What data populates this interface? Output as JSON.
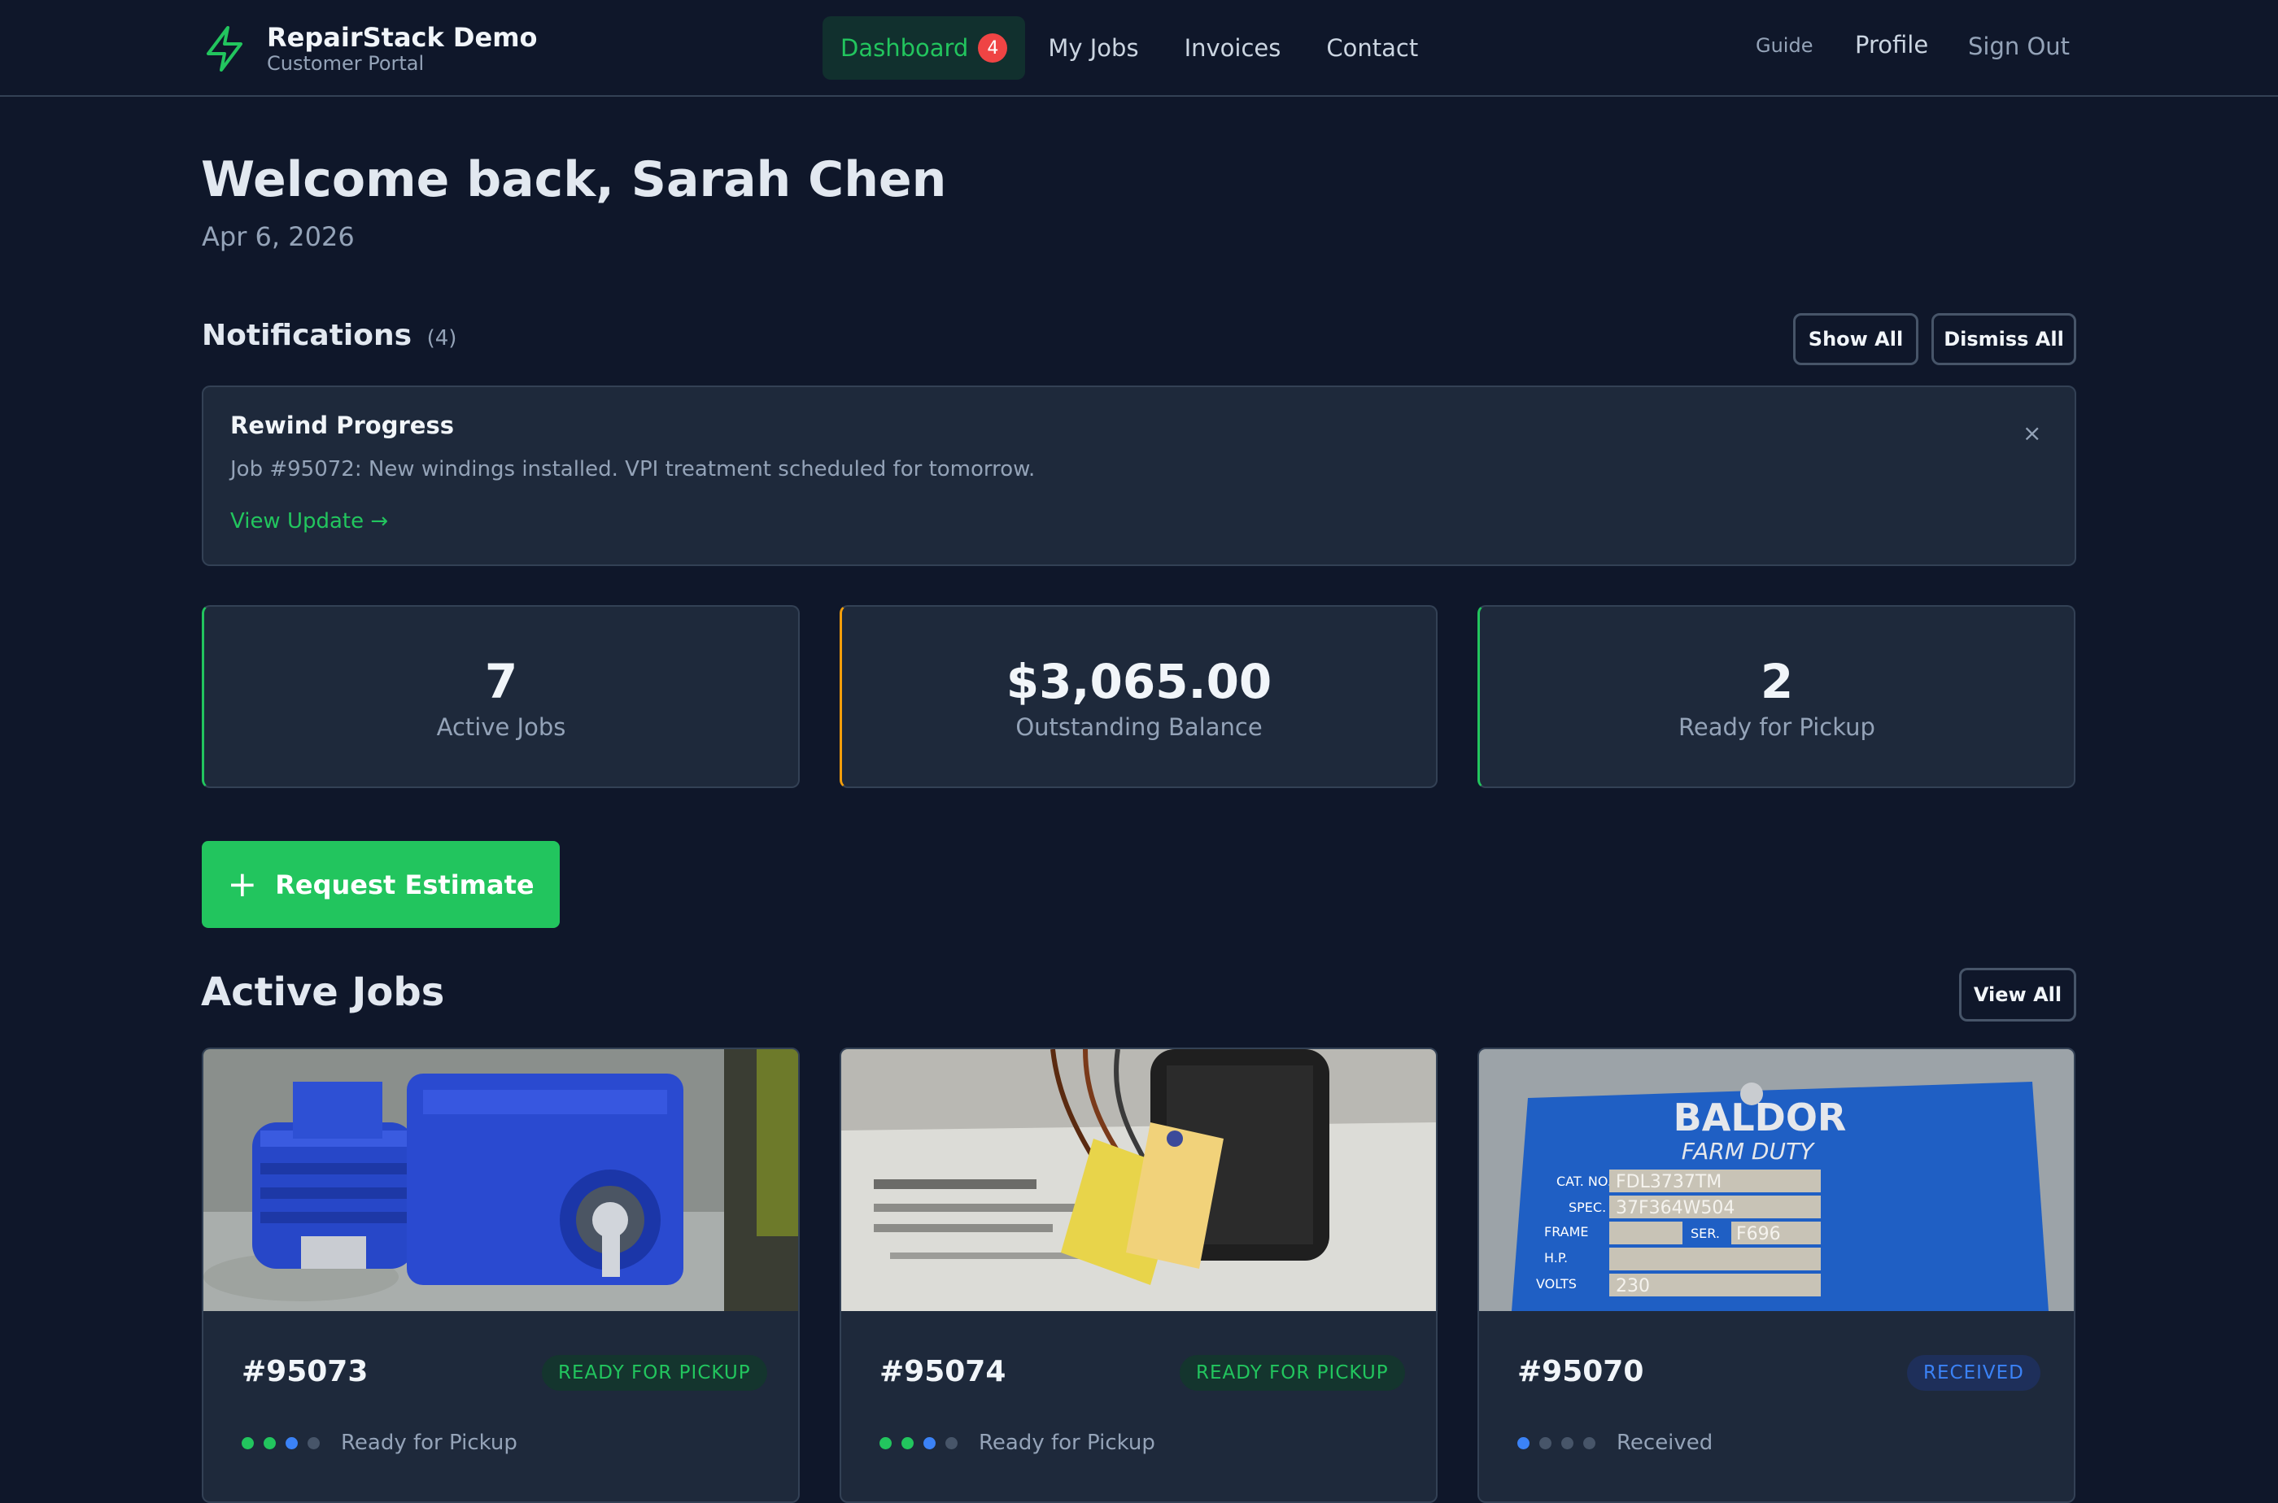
{
  "brand": {
    "name": "RepairStack Demo",
    "subtitle": "Customer Portal"
  },
  "nav": {
    "items": [
      {
        "label": "Dashboard",
        "badge": "4",
        "active": true
      },
      {
        "label": "My Jobs"
      },
      {
        "label": "Invoices"
      },
      {
        "label": "Contact"
      }
    ],
    "guide": "Guide",
    "profile": "Profile",
    "sign_out": "Sign Out"
  },
  "welcome": {
    "title": "Welcome back, Sarah Chen",
    "date": "Apr 6, 2026"
  },
  "notifications": {
    "title": "Notifications",
    "count": "(4)",
    "show_all": "Show All",
    "dismiss_all": "Dismiss All",
    "card": {
      "title": "Rewind Progress",
      "body": "Job #95072: New windings installed. VPI treatment scheduled for tomorrow.",
      "link": "View Update →",
      "close": "×"
    }
  },
  "stats": [
    {
      "value": "7",
      "label": "Active Jobs",
      "accent": "#22c55e"
    },
    {
      "value": "$3,065.00",
      "label": "Outstanding Balance",
      "accent": "#f59e0b"
    },
    {
      "value": "2",
      "label": "Ready for Pickup",
      "accent": "#22c55e"
    }
  ],
  "request_estimate": {
    "icon": "+",
    "label": "Request Estimate"
  },
  "active_jobs": {
    "title": "Active Jobs",
    "view_all": "View All",
    "jobs": [
      {
        "number": "#95073",
        "status": "READY FOR PICKUP",
        "stage": "Ready for Pickup",
        "photo": "blue-gear-motor-photo"
      },
      {
        "number": "#95074",
        "status": "READY FOR PICKUP",
        "stage": "Ready for Pickup",
        "photo": "motor-with-tag-photo"
      },
      {
        "number": "#95070",
        "status": "RECEIVED",
        "stage": "Received",
        "photo": "baldor-nameplate-photo",
        "nameplate": {
          "maker": "BALDOR",
          "line": "FARM DUTY",
          "cat_no_label": "CAT. NO.",
          "cat_no": "FDL3737TM",
          "spec_label": "SPEC.",
          "spec": "37F364W504",
          "frame_label": "FRAME",
          "ser_label": "SER.",
          "ser": "F696",
          "hp_label": "H.P.",
          "volts_label": "VOLTS",
          "volts": "230"
        }
      }
    ]
  },
  "colors": {
    "bg": "#0f172a",
    "card": "#1e293b",
    "accent": "#22c55e",
    "warn": "#f59e0b",
    "info": "#3b82f6",
    "danger": "#ef4444"
  }
}
